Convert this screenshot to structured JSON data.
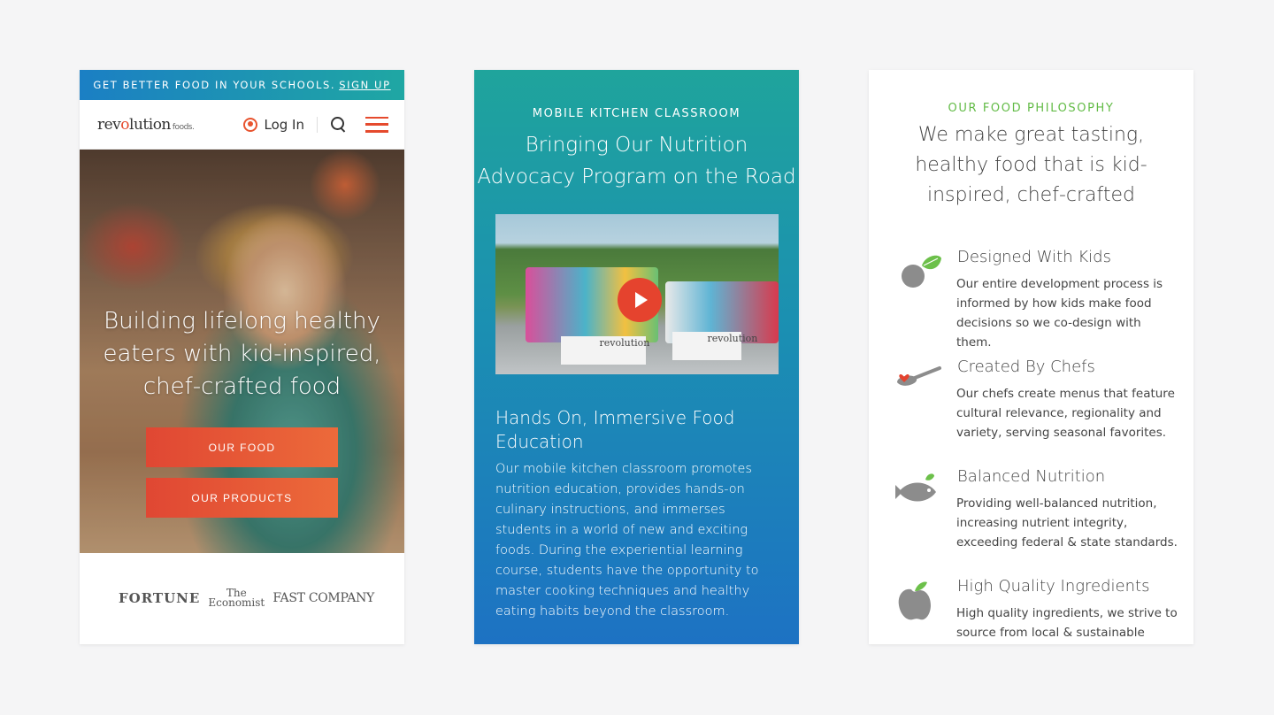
{
  "phone1": {
    "promo_text": "GET BETTER FOOD IN YOUR SCHOOLS.",
    "promo_link": "SIGN UP",
    "logo_main": "rev",
    "logo_o": "o",
    "logo_rest": "lution",
    "logo_suffix": "foods.",
    "login_label": "Log In",
    "hero_title": "Building lifelong healthy eaters with kid-inspired, chef-crafted food",
    "cta_primary": "OUR FOOD",
    "cta_secondary": "OUR PRODUCTS",
    "press": {
      "fortune": "FORTUNE",
      "economist_line1": "The",
      "economist_line2": "Economist",
      "fastcompany": "FAST COMPANY"
    }
  },
  "phone2": {
    "eyebrow": "MOBILE KITCHEN CLASSROOM",
    "title": "Bringing Our Nutrition Advocacy Program on the Road",
    "video_logo": "revolution",
    "subtitle": "Hands On, Immersive Food Education",
    "body": "Our mobile kitchen classroom promotes nutrition education, provides hands-on culinary instructions, and immerses students in a world of new and exciting foods. During the experiential learning course, students have the opportunity to master cooking techniques and healthy eating habits beyond the classroom."
  },
  "phone3": {
    "eyebrow": "OUR FOOD PHILOSOPHY",
    "title": "We make great tasting, healthy food that is kid-inspired, chef-crafted",
    "features": [
      {
        "icon": "kale-leaf-icon",
        "title": "Designed With Kids",
        "body": "Our entire development process is informed by how kids make food decisions so we co-design with them."
      },
      {
        "icon": "spoon-heart-icon",
        "title": "Created By Chefs",
        "body": "Our chefs create menus that feature cultural relevance, regionality and variety, serving seasonal favorites."
      },
      {
        "icon": "fish-icon",
        "title": "Balanced Nutrition",
        "body": "Providing well-balanced nutrition, increasing nutrient integrity, exceeding federal & state standards."
      },
      {
        "icon": "apple-icon",
        "title": "High Quality Ingredients",
        "body": "High quality ingredients, we strive to source from local & sustainable"
      }
    ]
  },
  "colors": {
    "brand_orange": "#e54a2d",
    "accent_green": "#62bb46",
    "promo_blue": "#1b7fc4",
    "teal": "#1fa49c"
  }
}
